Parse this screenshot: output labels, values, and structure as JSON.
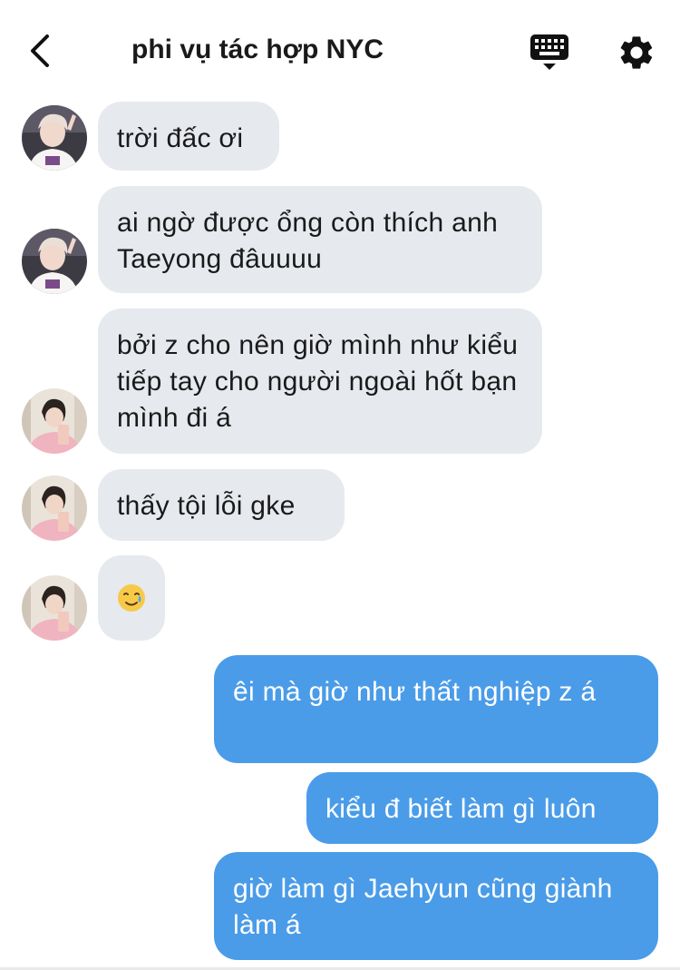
{
  "header": {
    "title": "phi vụ tác hợp NYC"
  },
  "icons": {
    "back": "chevron-left-icon",
    "keyboard": "keyboard-icon",
    "settings": "gear-icon"
  },
  "colors": {
    "incoming_bubble": "#e6e9ee",
    "outgoing_bubble": "#4a9ce8",
    "outgoing_text": "#ffffff"
  },
  "messages": [
    {
      "sender": "other",
      "avatar": "avatar-1",
      "text": "trời đấc ơi"
    },
    {
      "sender": "other",
      "avatar": "avatar-1",
      "text": "ai ngờ được ổng còn thích anh Taeyong đâuuuu"
    },
    {
      "sender": "other",
      "avatar": "avatar-2",
      "text": "bởi z cho nên giờ mình như kiểu tiếp tay cho người ngoài hốt bạn mình đi á"
    },
    {
      "sender": "other",
      "avatar": "avatar-2",
      "text": "thấy tội lỗi gke"
    },
    {
      "sender": "other",
      "avatar": "avatar-2",
      "text": "🥲"
    },
    {
      "sender": "me",
      "text": "êi mà giờ như thất nghiệp z á"
    },
    {
      "sender": "me",
      "text": "kiểu đ biết làm gì luôn"
    },
    {
      "sender": "me",
      "text": "giờ làm gì Jaehyun cũng giành làm á"
    }
  ]
}
